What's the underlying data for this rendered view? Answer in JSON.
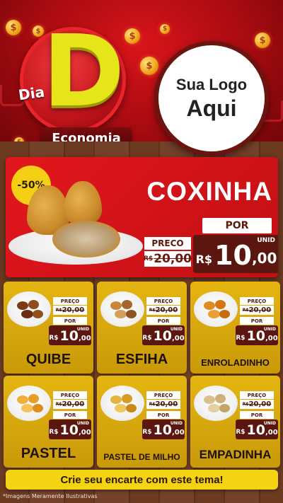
{
  "header": {
    "dia": "Dia",
    "big_letter": "D",
    "economia": "Economia",
    "logo_line1": "Sua Logo",
    "logo_line2": "Aqui"
  },
  "hero": {
    "discount": "-50%",
    "product": "COXINHA",
    "preco_label": "PRECO",
    "old_currency": "R$",
    "old_price": "20,00",
    "por_label": "POR",
    "unid_label": "UNID",
    "new_currency": "R$",
    "new_int": "10",
    "new_dec": ",00"
  },
  "items": [
    {
      "name": "QUIBE",
      "preco_label": "PREÇO",
      "old_currency": "R$",
      "old_price": "20,00",
      "por_label": "POR",
      "unid_label": "UNID",
      "new_currency": "R$",
      "new_int": "10",
      "new_dec": ",00"
    },
    {
      "name": "ESFIHA",
      "preco_label": "PREÇO",
      "old_currency": "R$",
      "old_price": "20,00",
      "por_label": "POR",
      "unid_label": "UNID",
      "new_currency": "R$",
      "new_int": "10",
      "new_dec": ",00"
    },
    {
      "name": "ENROLADINHO",
      "preco_label": "PREÇO",
      "old_currency": "R$",
      "old_price": "20,00",
      "por_label": "POR",
      "unid_label": "UNID",
      "new_currency": "R$",
      "new_int": "10",
      "new_dec": ",00"
    },
    {
      "name": "PASTEL",
      "preco_label": "PREÇO",
      "old_currency": "R$",
      "old_price": "20,00",
      "por_label": "POR",
      "unid_label": "UNID",
      "new_currency": "R$",
      "new_int": "10",
      "new_dec": ",00"
    },
    {
      "name": "PASTEL DE MILHO",
      "preco_label": "PREÇO",
      "old_currency": "R$",
      "old_price": "20,00",
      "por_label": "POR",
      "unid_label": "UNID",
      "new_currency": "R$",
      "new_int": "10",
      "new_dec": ",00"
    },
    {
      "name": "EMPADINHA",
      "preco_label": "PREÇO",
      "old_currency": "R$",
      "old_price": "20,00",
      "por_label": "POR",
      "unid_label": "UNID",
      "new_currency": "R$",
      "new_int": "10",
      "new_dec": ",00"
    }
  ],
  "cta": "Crie seu encarte com este tema!",
  "footnote": "*Imagens Meramente Ilustrativas",
  "icons": [
    "dollar-coin-icon",
    "shopping-cart-icon"
  ],
  "colors": {
    "red": "#d9141b",
    "yellow": "#f4d313",
    "brown": "#5b1610"
  }
}
